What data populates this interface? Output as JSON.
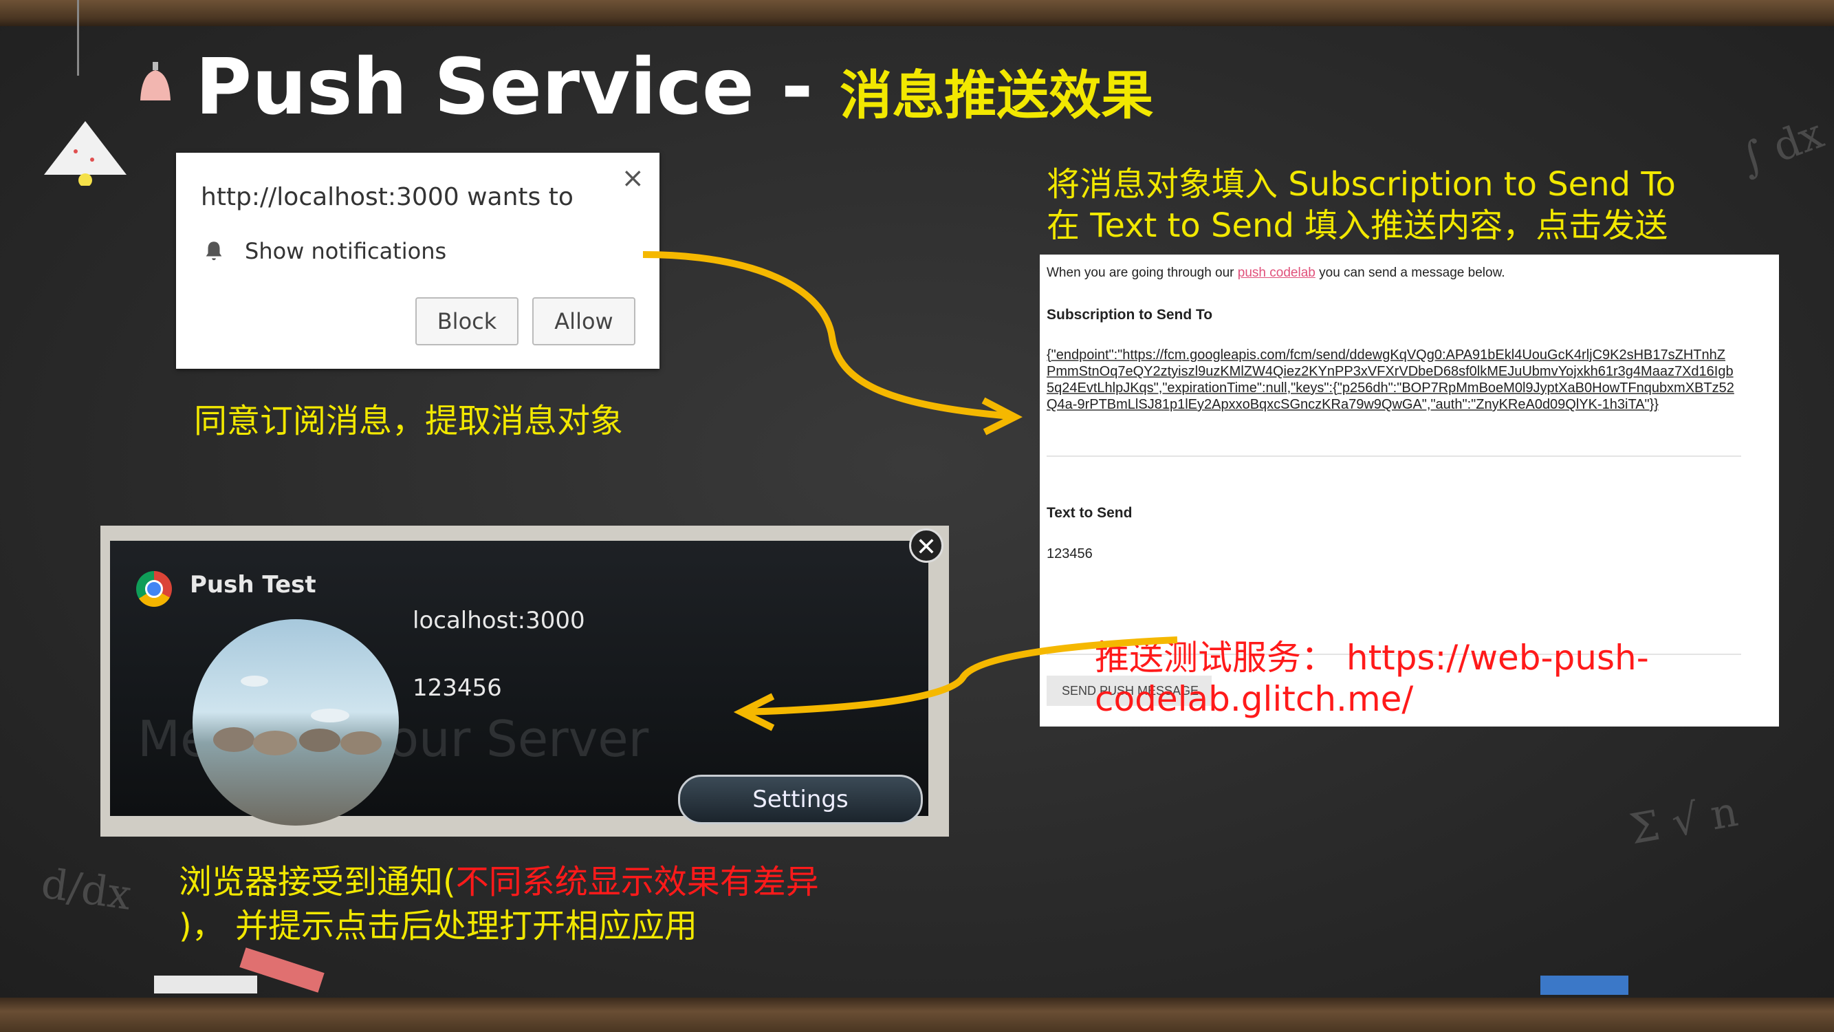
{
  "slide": {
    "title_main": "Push Service - ",
    "title_sub": "消息推送效果",
    "caption_subscribe": "同意订阅消息，提取消息对象",
    "instruction_line1": "将消息对象填入 Subscription to Send To",
    "instruction_line2": "在 Text to Send 填入推送内容，点击发送",
    "service_text": "推送测试服务： https://web-push-codelab.glitch.me/",
    "caption_receive_a": "浏览器接受到通知(",
    "caption_receive_red": "不同系统显示效果有差异",
    "caption_receive_b": ")， 并提示点击后处理打开相应应用"
  },
  "permission_popup": {
    "origin_text": "http://localhost:3000 wants to",
    "permission_text": "Show notifications",
    "block_label": "Block",
    "allow_label": "Allow",
    "close_glyph": "×"
  },
  "notification": {
    "app_title": "Push Test",
    "host": "localhost:3000",
    "body": "123456",
    "settings_label": "Settings",
    "close_glyph": "✕",
    "background_text": "Me               From Your Server"
  },
  "web_form": {
    "intro_prefix": "When you are going through our ",
    "intro_link": "push codelab",
    "intro_suffix": " you can send a message below.",
    "subscription_label": "Subscription to Send To",
    "subscription_value": "{\"endpoint\":\"https://fcm.googleapis.com/fcm/send/ddewgKqVQg0:APA91bEkl4UouGcK4rljC9K2sHB17sZHTnhZPmmStnOq7eQY2ztyiszl9uzKMlZW4Qiez2KYnPP3xVFXrVDbeD68sf0lkMEJuUbmvYojxkh61r3g4Maaz7Xd16Igb5q24EvtLhlpJKqs\",\"expirationTime\":null,\"keys\":{\"p256dh\":\"BOP7RpMmBoeM0l9JyptXaB0HowTFnqubxmXBTz52Q4a-9rPTBmLlSJ81p1lEy2ApxxoBqxcSGnczKRa79w9QwGA\",\"auth\":\"ZnyKReA0d09QlYK-1h3iTA\"}}",
    "text_label": "Text to Send",
    "text_value": "123456",
    "send_label": "SEND PUSH MESSAGE"
  },
  "colors": {
    "accent_yellow": "#f2e800",
    "accent_red": "#ff1a1a",
    "arrow": "#f5b800"
  }
}
